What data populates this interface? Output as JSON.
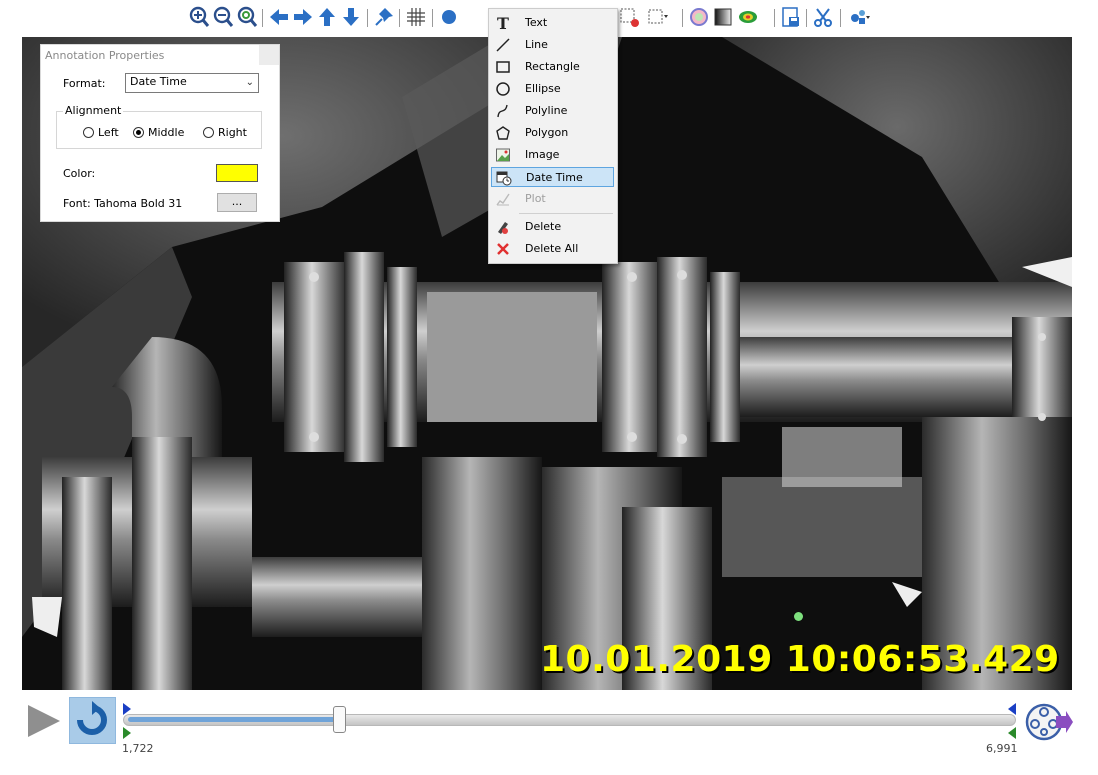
{
  "toolbar": {
    "buttons": [
      "zoom-in-icon",
      "zoom-out-icon",
      "zoom-fit-icon",
      "arrow-left-icon",
      "arrow-right-icon",
      "arrow-up-icon",
      "arrow-down-icon",
      "pin-icon",
      "grid-icon",
      "annotation-icon",
      "annotation-remove-icon",
      "selection-icon",
      "color-icon",
      "grayscale-icon",
      "colormap-icon",
      "save-icon",
      "scissors-icon",
      "tools-icon"
    ]
  },
  "menu": {
    "items": [
      {
        "label": "Text",
        "icon": "text-icon"
      },
      {
        "label": "Line",
        "icon": "line-icon"
      },
      {
        "label": "Rectangle",
        "icon": "rectangle-icon"
      },
      {
        "label": "Ellipse",
        "icon": "ellipse-icon"
      },
      {
        "label": "Polyline",
        "icon": "polyline-icon"
      },
      {
        "label": "Polygon",
        "icon": "polygon-icon"
      },
      {
        "label": "Image",
        "icon": "image-icon"
      },
      {
        "label": "Date Time",
        "icon": "calendar-clock-icon",
        "highlighted": true
      },
      {
        "label": "Plot",
        "icon": "plot-icon",
        "disabled": true
      },
      {
        "label": "Delete",
        "icon": "delete-icon"
      },
      {
        "label": "Delete All",
        "icon": "delete-all-icon"
      }
    ]
  },
  "properties": {
    "title": "Annotation Properties",
    "format_label": "Format:",
    "format_value": "Date Time",
    "alignment_label": "Alignment",
    "align_options": [
      "Left",
      "Middle",
      "Right"
    ],
    "align_selected": "Middle",
    "color_label": "Color:",
    "color_value": "#ffff00",
    "font_label": "Font: Tahoma Bold 31",
    "font_button": "..."
  },
  "viewer": {
    "timestamp": "10.01.2019 10:06:53.429"
  },
  "playback": {
    "start_frame": "1,722",
    "end_frame": "6,991",
    "position_fraction": 0.24,
    "accent": "#6fa3d8"
  }
}
